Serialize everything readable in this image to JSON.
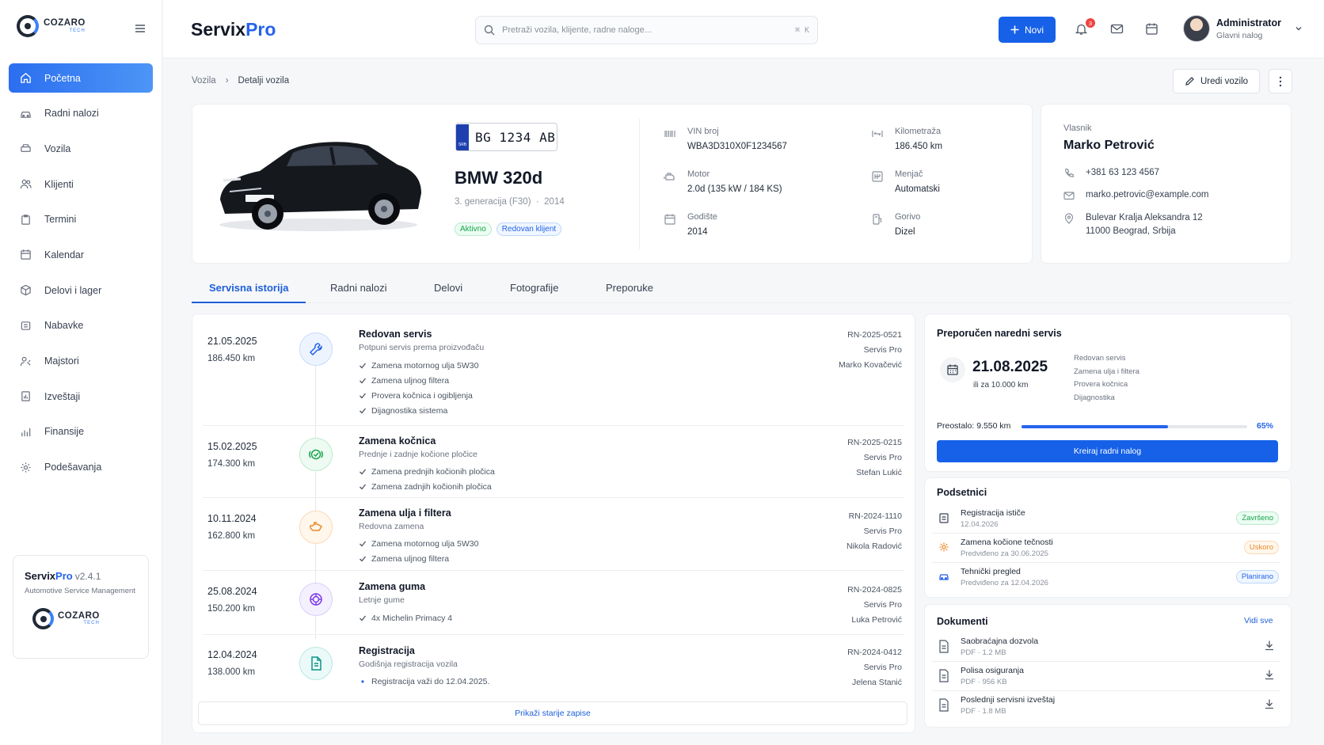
{
  "brand": {
    "name": "COZARO",
    "tag": "TECH"
  },
  "nav": [
    {
      "label": "Početna",
      "icon": "home-icon",
      "active": true
    },
    {
      "label": "Radni nalozi",
      "icon": "car-icon"
    },
    {
      "label": "Vozila",
      "icon": "vehicle-icon"
    },
    {
      "label": "Klijenti",
      "icon": "users-icon"
    },
    {
      "label": "Termini",
      "icon": "clipboard-icon"
    },
    {
      "label": "Kalendar",
      "icon": "calendar-icon"
    },
    {
      "label": "Delovi i lager",
      "icon": "box-icon"
    },
    {
      "label": "Nabavke",
      "icon": "cart-icon"
    },
    {
      "label": "Majstori",
      "icon": "mechanic-icon"
    },
    {
      "label": "Izveštaji",
      "icon": "report-icon"
    },
    {
      "label": "Finansije",
      "icon": "finance-icon"
    },
    {
      "label": "Podešavanja",
      "icon": "gear-icon"
    }
  ],
  "version_card": {
    "name_a": "Servix",
    "name_b": "Pro",
    "version": "v2.4.1",
    "subtitle": "Automotive Service Management"
  },
  "topbar": {
    "title_a": "Servix",
    "title_b": "Pro",
    "search_placeholder": "Pretraži vozila, klijente, radne naloge...",
    "shortcut": "⌘ K",
    "new_label": "Novi",
    "notif_count": "3",
    "user_name": "Administrator",
    "user_role": "Glavni nalog"
  },
  "breadcrumb": {
    "parent": "Vozila",
    "current": "Detalji vozila"
  },
  "actions": {
    "edit_label": "Uredi vozilo"
  },
  "vehicle": {
    "plate": "BG 1234 AB",
    "plate_country": "SRB",
    "model": "BMW 320d",
    "generation": "3. generacija (F30)",
    "year": "2014",
    "tags": [
      "Aktivno",
      "Redovan klijent"
    ],
    "specs": [
      {
        "label": "VIN broj",
        "value": "WBA3D310X0F1234567",
        "icon": "barcode-icon"
      },
      {
        "label": "Kilometraža",
        "value": "186.450 km",
        "icon": "odometer-icon"
      },
      {
        "label": "Motor",
        "value": "2.0d (135 kW / 184 KS)",
        "icon": "engine-icon"
      },
      {
        "label": "Menjač",
        "value": "Automatski",
        "icon": "gearbox-icon"
      },
      {
        "label": "Godište",
        "value": "2014",
        "icon": "calendar-icon"
      },
      {
        "label": "Gorivo",
        "value": "Dizel",
        "icon": "fuel-icon"
      }
    ]
  },
  "owner": {
    "label": "Vlasnik",
    "name": "Marko Petrović",
    "phone": "+381 63 123 4567",
    "email": "marko.petrovic@example.com",
    "address_line1": "Bulevar Kralja Aleksandra 12",
    "address_line2": "11000 Beograd, Srbija"
  },
  "tabs": [
    "Servisna istorija",
    "Radni nalozi",
    "Delovi",
    "Fotografije",
    "Preporuke"
  ],
  "history": [
    {
      "date": "21.05.2025",
      "km": "186.450 km",
      "title": "Redovan servis",
      "subtitle": "Potpuni servis prema proizvođaču",
      "items": [
        "Zamena motornog ulja 5W30",
        "Zamena uljnog filtera",
        "Provera kočnica i ogibljenja",
        "Dijagnostika sistema"
      ],
      "order": "RN-2025-0521",
      "shop": "Servis Pro",
      "mechanic": "Marko Kovačević",
      "icon": "wrench-icon"
    },
    {
      "date": "15.02.2025",
      "km": "174.300 km",
      "title": "Zamena kočnica",
      "subtitle": "Prednje i zadnje kočione pločice",
      "items": [
        "Zamena prednjih kočionih pločica",
        "Zamena zadnjih kočionih pločica"
      ],
      "order": "RN-2025-0215",
      "shop": "Servis Pro",
      "mechanic": "Stefan Lukić",
      "icon": "brake-icon"
    },
    {
      "date": "10.11.2024",
      "km": "162.800 km",
      "title": "Zamena ulja i filtera",
      "subtitle": "Redovna zamena",
      "items": [
        "Zamena motornog ulja 5W30",
        "Zamena uljnog filtera"
      ],
      "order": "RN-2024-1110",
      "shop": "Servis Pro",
      "mechanic": "Nikola Radović",
      "icon": "oil-can-icon"
    },
    {
      "date": "25.08.2024",
      "km": "150.200 km",
      "title": "Zamena guma",
      "subtitle": "Letnje gume",
      "items": [
        "4x Michelin Primacy 4"
      ],
      "order": "RN-2024-0825",
      "shop": "Servis Pro",
      "mechanic": "Luka Petrović",
      "icon": "tire-icon"
    },
    {
      "date": "12.04.2024",
      "km": "138.000 km",
      "title": "Registracija",
      "subtitle": "Godišnja registracija vozila",
      "items": [
        "Registracija važi do 12.04.2025."
      ],
      "order": "RN-2024-0412",
      "shop": "Servis Pro",
      "mechanic": "Jelena Stanić",
      "icon": "document-icon"
    }
  ],
  "history_more": "Prikaži starije zapise",
  "next_service": {
    "title": "Preporučen naredni servis",
    "date": "21.08.2025",
    "note": "ili za 10.000 km",
    "items": [
      "Redovan servis",
      "Zamena ulja i filtera",
      "Provera kočnica",
      "Dijagnostika"
    ],
    "remaining_label": "Preostalo: 9.550 km",
    "progress_pct": 65,
    "progress_text": "65%",
    "button": "Kreiraj radni nalog"
  },
  "reminders": {
    "title": "Podsetnici",
    "items": [
      {
        "title": "Registracija ističe",
        "date": "12.04.2026",
        "status": "Završeno",
        "tone": "green"
      },
      {
        "title": "Zamena kočione tečnosti",
        "date": "Predviđeno za 30.06.2025",
        "status": "Uskoro",
        "tone": "orange"
      },
      {
        "title": "Tehnički pregled",
        "date": "Predviđeno za 12.04.2026",
        "status": "Planirano",
        "tone": "blue"
      }
    ]
  },
  "documents": {
    "title": "Dokumenti",
    "see_all": "Vidi sve",
    "items": [
      {
        "name": "Saobraćajna dozvola",
        "meta": "PDF · 1.2 MB"
      },
      {
        "name": "Polisa osiguranja",
        "meta": "PDF · 956 KB"
      },
      {
        "name": "Poslednji servisni izveštaj",
        "meta": "PDF · 1.8 MB"
      }
    ]
  },
  "colors": {
    "primary": "#1661e8",
    "success": "#16a34a",
    "warning": "#ea8a2b"
  }
}
